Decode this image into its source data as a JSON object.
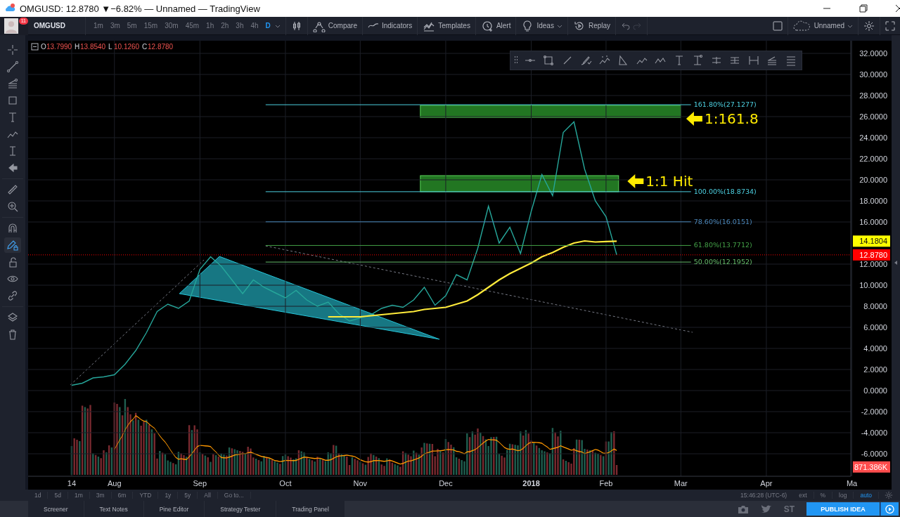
{
  "window": {
    "title": "OMGUSD: 12.8780 ▼−6.82% — Unnamed — TradingView"
  },
  "avatar": {
    "badge": "11"
  },
  "toolbar": {
    "symbol": "OMGUSD",
    "intervals": [
      {
        "label": "1m",
        "selected": false
      },
      {
        "label": "3m",
        "selected": false
      },
      {
        "label": "5m",
        "selected": false
      },
      {
        "label": "15m",
        "selected": false
      },
      {
        "label": "30m",
        "selected": false
      },
      {
        "label": "45m",
        "selected": false
      },
      {
        "label": "1h",
        "selected": false
      },
      {
        "label": "2h",
        "selected": false
      },
      {
        "label": "3h",
        "selected": false
      },
      {
        "label": "4h",
        "selected": false
      },
      {
        "label": "D",
        "selected": true
      }
    ],
    "buttons": [
      {
        "label": "Compare",
        "kind": "compare"
      },
      {
        "label": "Indicators",
        "kind": "indicators"
      },
      {
        "label": "Templates",
        "kind": "templates"
      },
      {
        "label": "Alert",
        "kind": "alert"
      },
      {
        "label": "Ideas",
        "kind": "ideas"
      },
      {
        "label": "Replay",
        "kind": "replay"
      }
    ],
    "layout_name": "Unnamed"
  },
  "left_toolbar": {
    "stay_in_drawing_mode": true
  },
  "legend": [
    {
      "key": "O",
      "value": "13.7990"
    },
    {
      "key": "H",
      "value": "13.8540"
    },
    {
      "key": "L",
      "value": "10.1260"
    },
    {
      "key": "C",
      "value": "12.8780"
    }
  ],
  "chart": {
    "chart_data": {
      "type": "line",
      "grid": true,
      "categories": [
        "14",
        null,
        null,
        null,
        "Aug",
        null,
        null,
        null,
        null,
        null,
        null,
        null,
        "Sep",
        null,
        null,
        null,
        null,
        null,
        null,
        null,
        "Oct",
        null,
        null,
        null,
        null,
        null,
        null,
        "Nov",
        null,
        null,
        null,
        null,
        null,
        null,
        null,
        "Dec",
        null,
        null,
        null,
        null,
        null,
        null,
        null,
        "2018",
        null,
        null,
        null,
        null,
        null,
        null,
        "Feb",
        null,
        null,
        null,
        null,
        null,
        null,
        "Mar",
        null,
        null,
        null,
        null,
        null,
        null,
        null,
        "Apr",
        null,
        null,
        null,
        null,
        null,
        null,
        null,
        "Ma"
      ],
      "series": [
        {
          "color": "#26a69a",
          "values": [
            0.5,
            0.7,
            1.2,
            1.3,
            1.5,
            2.5,
            3.8,
            5.5,
            7.5,
            8.2,
            7.8,
            8.5,
            11.5,
            12.7,
            11.8,
            10.5,
            9.2,
            10.5,
            9.8,
            9.3,
            8.8,
            9.5,
            8.6,
            8.0,
            8.4,
            7.3,
            6.6,
            6.9,
            7.2,
            7.8,
            8.1,
            7.9,
            8.6,
            9.8,
            8.1,
            9.0,
            11.0,
            10.5,
            13.5,
            17.5,
            14.0,
            15.5,
            13.0,
            17.0,
            20.5,
            18.5,
            24.5,
            25.5,
            21.0,
            18.0,
            16.5,
            12.88,
            null,
            null,
            null,
            null,
            null,
            null,
            null,
            null,
            null,
            null,
            null,
            null,
            null,
            null,
            null,
            null,
            null,
            null,
            null,
            null,
            null,
            null
          ]
        },
        {
          "color": "#ffeb3b",
          "values": [
            null,
            null,
            null,
            null,
            null,
            null,
            null,
            null,
            null,
            null,
            null,
            null,
            null,
            null,
            null,
            null,
            null,
            null,
            null,
            null,
            null,
            null,
            null,
            null,
            7.0,
            7.0,
            7.0,
            7.0,
            7.1,
            7.2,
            7.3,
            7.4,
            7.5,
            7.7,
            7.8,
            7.9,
            8.2,
            8.5,
            9.1,
            9.8,
            10.5,
            11.1,
            11.6,
            12.1,
            12.7,
            13.1,
            13.6,
            14.0,
            14.2,
            14.1,
            14.15,
            14.18,
            null,
            null,
            null,
            null,
            null,
            null,
            null,
            null,
            null,
            null,
            null,
            null,
            null,
            null,
            null,
            null,
            null,
            null,
            null,
            null,
            null,
            null
          ]
        }
      ],
      "ylim": [
        -8,
        33.2
      ],
      "yticks": [
        {
          "value": 32,
          "label": "32.0000"
        },
        {
          "value": 30,
          "label": "30.0000"
        },
        {
          "value": 28,
          "label": "28.0000"
        },
        {
          "value": 26,
          "label": "26.0000"
        },
        {
          "value": 24,
          "label": "24.0000"
        },
        {
          "value": 22,
          "label": "22.0000"
        },
        {
          "value": 20,
          "label": "20.0000"
        },
        {
          "value": 18,
          "label": "18.0000"
        },
        {
          "value": 16,
          "label": "16.0000"
        },
        {
          "value": 12,
          "label": "12.0000"
        },
        {
          "value": 10,
          "label": "10.0000"
        },
        {
          "value": 8,
          "label": "8.0000"
        },
        {
          "value": 6,
          "label": "6.0000"
        },
        {
          "value": 4,
          "label": "4.0000"
        },
        {
          "value": 2,
          "label": "2.0000"
        },
        {
          "value": 0,
          "label": "0.0000"
        },
        {
          "value": -2,
          "label": "-2.0000"
        },
        {
          "value": -4,
          "label": "-4.0000"
        },
        {
          "value": -6,
          "label": "-6.0000"
        }
      ]
    },
    "fib_levels": [
      {
        "label": "161.80%(27.1277)",
        "color": "#4dd0e1"
      },
      {
        "label": "100.00%(18.8734)",
        "color": "#4dd0e1"
      },
      {
        "label": "78.60%(16.0151)",
        "color": "#4a86b8"
      },
      {
        "label": "61.80%(13.7712)",
        "color": "#43a047"
      },
      {
        "label": "50.00%(12.1952)",
        "color": "#66bb6a"
      }
    ],
    "callouts": [
      "1:161.8",
      "1:1 Hit"
    ],
    "price_tags": [
      {
        "label": "14.1804",
        "color": "#ffff00",
        "kind": "moving_average"
      },
      {
        "label": "12.8780",
        "color": "#ff0000",
        "kind": "last_price"
      },
      {
        "label": "871.386K",
        "color": "#ff4d4d",
        "kind": "volume"
      }
    ]
  },
  "range_bar": {
    "ranges": [
      "1d",
      "5d",
      "1m",
      "3m",
      "6m",
      "YTD",
      "1y",
      "5y",
      "All",
      "Go to..."
    ],
    "time": "15:46:28 (UTC-6)",
    "scale_options": [
      {
        "label": "ext",
        "selected": false
      },
      {
        "label": "%",
        "selected": false
      },
      {
        "label": "log",
        "selected": false
      },
      {
        "label": "auto",
        "selected": true
      }
    ]
  },
  "bottom_tabs": [
    "Screener",
    "Text Notes",
    "Pine Editor",
    "Strategy Tester",
    "Trading Panel"
  ],
  "share": {
    "stocktwits": "ST",
    "publish": "PUBLISH IDEA"
  }
}
